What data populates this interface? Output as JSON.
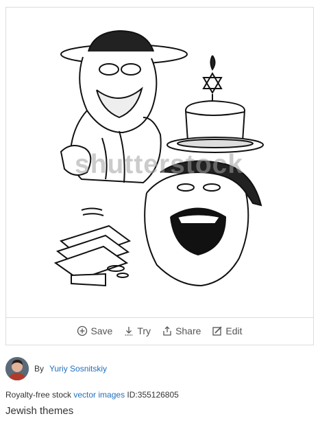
{
  "image": {
    "watermark": "shutterstock",
    "alt": "Jewish themes"
  },
  "actions": [
    {
      "label": "Save",
      "icon": "plus-circle-icon"
    },
    {
      "label": "Try",
      "icon": "download-icon"
    },
    {
      "label": "Share",
      "icon": "share-icon"
    },
    {
      "label": "Edit",
      "icon": "edit-icon"
    }
  ],
  "author": {
    "prefix": "By",
    "name": "Yuriy Sosnitskiy"
  },
  "license": {
    "prefix": "Royalty-free stock",
    "link": "vector images",
    "id_label": "ID:",
    "id": "355126805"
  },
  "title": "Jewish themes",
  "colors": {
    "link": "#1f6fbd",
    "border": "#dcdcdc",
    "text": "#333333"
  }
}
